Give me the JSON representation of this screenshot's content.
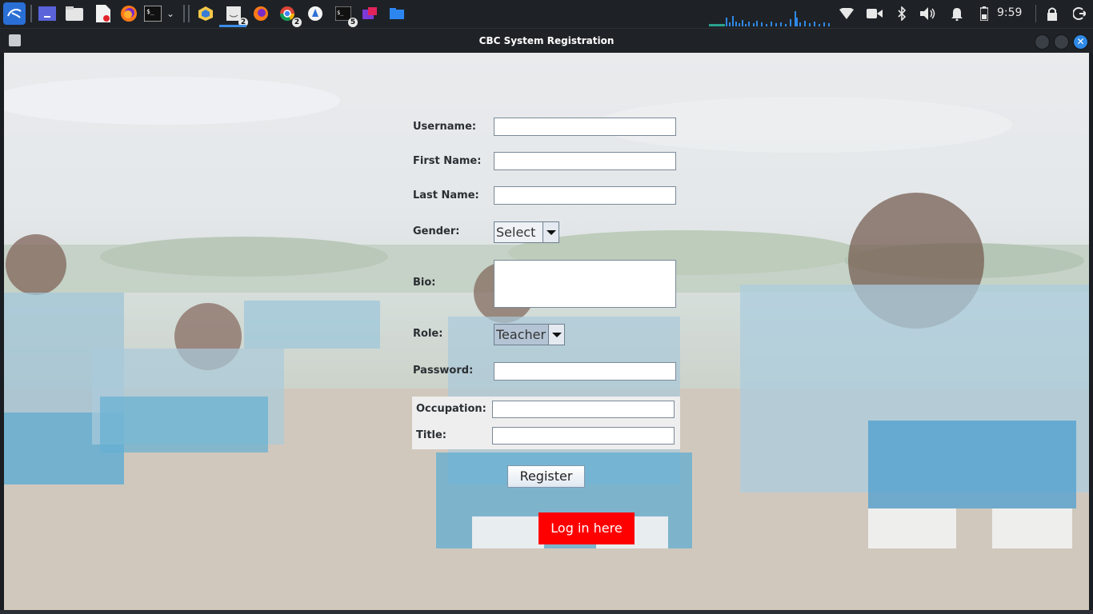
{
  "taskbar": {
    "badges": {
      "editor": "2",
      "chrome": "2",
      "terminal": "5"
    },
    "clock": "9:59"
  },
  "window": {
    "title": "CBC System Registration"
  },
  "form": {
    "username_label": "Username:",
    "first_name_label": "First Name:",
    "last_name_label": "Last Name:",
    "gender_label": "Gender:",
    "gender_value": "Select",
    "bio_label": "Bio:",
    "role_label": "Role:",
    "role_value": "Teacher",
    "password_label": "Password:",
    "occupation_label": "Occupation:",
    "title_label": "Title:",
    "register_label": "Register",
    "login_label": "Log in here"
  },
  "colors": {
    "login_button": "#ff0000",
    "title_bar": "#1f2226",
    "taskbar": "#1e2227",
    "accent": "#2f89e6"
  }
}
